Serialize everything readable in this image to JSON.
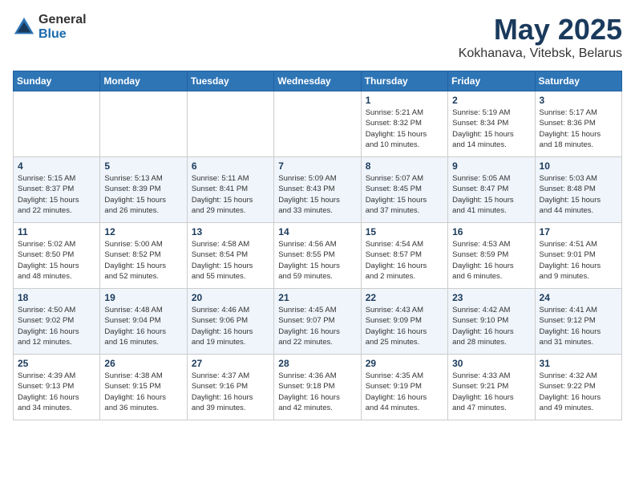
{
  "header": {
    "logo_general": "General",
    "logo_blue": "Blue",
    "title": "May 2025",
    "location": "Kokhanava, Vitebsk, Belarus"
  },
  "weekdays": [
    "Sunday",
    "Monday",
    "Tuesday",
    "Wednesday",
    "Thursday",
    "Friday",
    "Saturday"
  ],
  "weeks": [
    [
      {
        "day": "",
        "info": ""
      },
      {
        "day": "",
        "info": ""
      },
      {
        "day": "",
        "info": ""
      },
      {
        "day": "",
        "info": ""
      },
      {
        "day": "1",
        "info": "Sunrise: 5:21 AM\nSunset: 8:32 PM\nDaylight: 15 hours\nand 10 minutes."
      },
      {
        "day": "2",
        "info": "Sunrise: 5:19 AM\nSunset: 8:34 PM\nDaylight: 15 hours\nand 14 minutes."
      },
      {
        "day": "3",
        "info": "Sunrise: 5:17 AM\nSunset: 8:36 PM\nDaylight: 15 hours\nand 18 minutes."
      }
    ],
    [
      {
        "day": "4",
        "info": "Sunrise: 5:15 AM\nSunset: 8:37 PM\nDaylight: 15 hours\nand 22 minutes."
      },
      {
        "day": "5",
        "info": "Sunrise: 5:13 AM\nSunset: 8:39 PM\nDaylight: 15 hours\nand 26 minutes."
      },
      {
        "day": "6",
        "info": "Sunrise: 5:11 AM\nSunset: 8:41 PM\nDaylight: 15 hours\nand 29 minutes."
      },
      {
        "day": "7",
        "info": "Sunrise: 5:09 AM\nSunset: 8:43 PM\nDaylight: 15 hours\nand 33 minutes."
      },
      {
        "day": "8",
        "info": "Sunrise: 5:07 AM\nSunset: 8:45 PM\nDaylight: 15 hours\nand 37 minutes."
      },
      {
        "day": "9",
        "info": "Sunrise: 5:05 AM\nSunset: 8:47 PM\nDaylight: 15 hours\nand 41 minutes."
      },
      {
        "day": "10",
        "info": "Sunrise: 5:03 AM\nSunset: 8:48 PM\nDaylight: 15 hours\nand 44 minutes."
      }
    ],
    [
      {
        "day": "11",
        "info": "Sunrise: 5:02 AM\nSunset: 8:50 PM\nDaylight: 15 hours\nand 48 minutes."
      },
      {
        "day": "12",
        "info": "Sunrise: 5:00 AM\nSunset: 8:52 PM\nDaylight: 15 hours\nand 52 minutes."
      },
      {
        "day": "13",
        "info": "Sunrise: 4:58 AM\nSunset: 8:54 PM\nDaylight: 15 hours\nand 55 minutes."
      },
      {
        "day": "14",
        "info": "Sunrise: 4:56 AM\nSunset: 8:55 PM\nDaylight: 15 hours\nand 59 minutes."
      },
      {
        "day": "15",
        "info": "Sunrise: 4:54 AM\nSunset: 8:57 PM\nDaylight: 16 hours\nand 2 minutes."
      },
      {
        "day": "16",
        "info": "Sunrise: 4:53 AM\nSunset: 8:59 PM\nDaylight: 16 hours\nand 6 minutes."
      },
      {
        "day": "17",
        "info": "Sunrise: 4:51 AM\nSunset: 9:01 PM\nDaylight: 16 hours\nand 9 minutes."
      }
    ],
    [
      {
        "day": "18",
        "info": "Sunrise: 4:50 AM\nSunset: 9:02 PM\nDaylight: 16 hours\nand 12 minutes."
      },
      {
        "day": "19",
        "info": "Sunrise: 4:48 AM\nSunset: 9:04 PM\nDaylight: 16 hours\nand 16 minutes."
      },
      {
        "day": "20",
        "info": "Sunrise: 4:46 AM\nSunset: 9:06 PM\nDaylight: 16 hours\nand 19 minutes."
      },
      {
        "day": "21",
        "info": "Sunrise: 4:45 AM\nSunset: 9:07 PM\nDaylight: 16 hours\nand 22 minutes."
      },
      {
        "day": "22",
        "info": "Sunrise: 4:43 AM\nSunset: 9:09 PM\nDaylight: 16 hours\nand 25 minutes."
      },
      {
        "day": "23",
        "info": "Sunrise: 4:42 AM\nSunset: 9:10 PM\nDaylight: 16 hours\nand 28 minutes."
      },
      {
        "day": "24",
        "info": "Sunrise: 4:41 AM\nSunset: 9:12 PM\nDaylight: 16 hours\nand 31 minutes."
      }
    ],
    [
      {
        "day": "25",
        "info": "Sunrise: 4:39 AM\nSunset: 9:13 PM\nDaylight: 16 hours\nand 34 minutes."
      },
      {
        "day": "26",
        "info": "Sunrise: 4:38 AM\nSunset: 9:15 PM\nDaylight: 16 hours\nand 36 minutes."
      },
      {
        "day": "27",
        "info": "Sunrise: 4:37 AM\nSunset: 9:16 PM\nDaylight: 16 hours\nand 39 minutes."
      },
      {
        "day": "28",
        "info": "Sunrise: 4:36 AM\nSunset: 9:18 PM\nDaylight: 16 hours\nand 42 minutes."
      },
      {
        "day": "29",
        "info": "Sunrise: 4:35 AM\nSunset: 9:19 PM\nDaylight: 16 hours\nand 44 minutes."
      },
      {
        "day": "30",
        "info": "Sunrise: 4:33 AM\nSunset: 9:21 PM\nDaylight: 16 hours\nand 47 minutes."
      },
      {
        "day": "31",
        "info": "Sunrise: 4:32 AM\nSunset: 9:22 PM\nDaylight: 16 hours\nand 49 minutes."
      }
    ]
  ]
}
